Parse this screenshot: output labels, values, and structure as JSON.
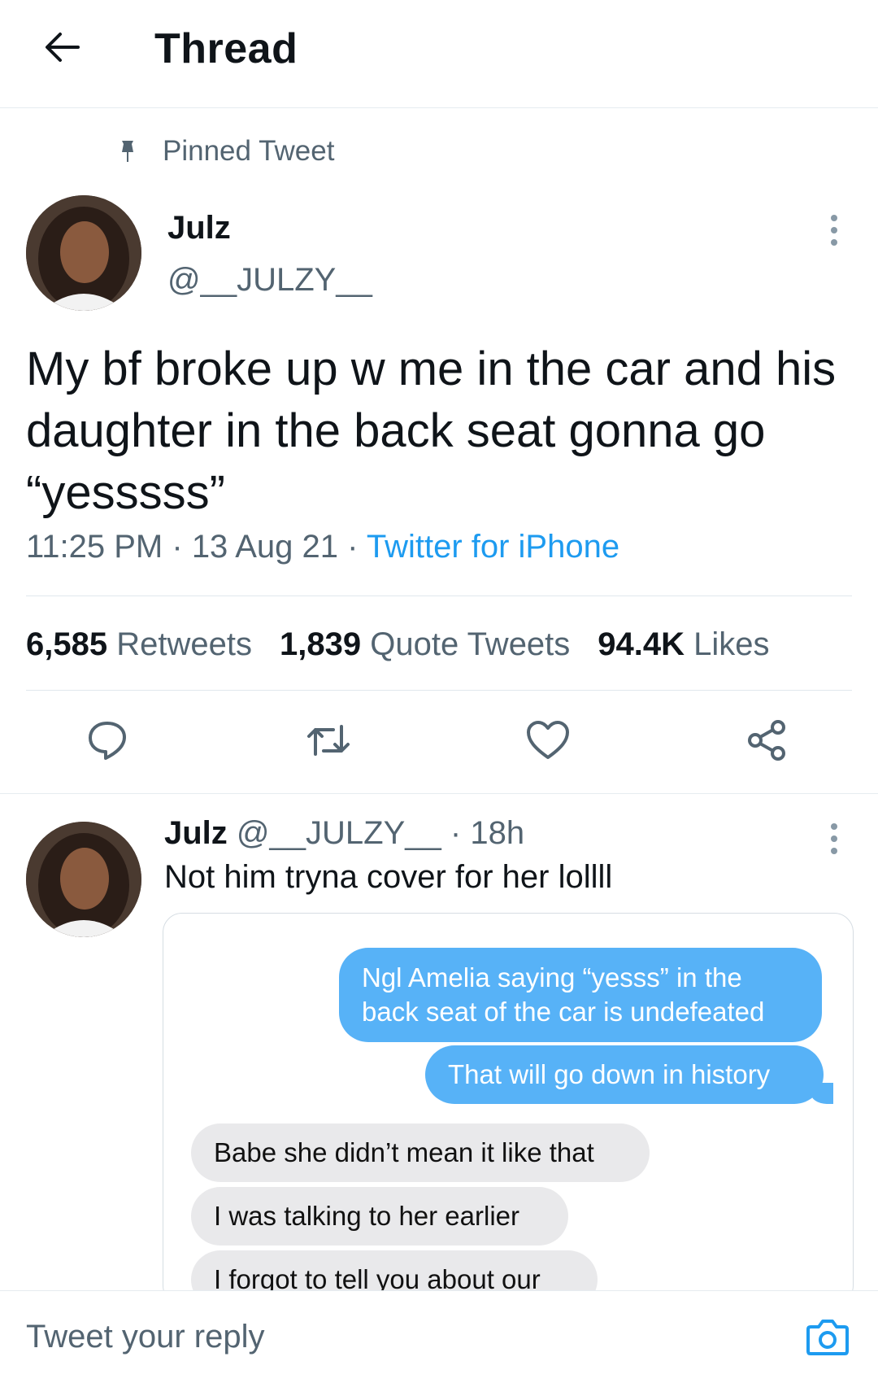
{
  "header": {
    "title": "Thread",
    "back_icon": "arrow-left-icon"
  },
  "pinned": {
    "label": "Pinned Tweet",
    "icon": "pin-icon"
  },
  "tweet": {
    "author_name": "Julz",
    "author_handle": "@__JULZY__",
    "text": "My bf broke up w me in the car and his daughter in the back seat gonna go “yesssss”",
    "time": "11:25 PM",
    "date": "13 Aug 21",
    "source": "Twitter for iPhone",
    "stats": {
      "retweets_count": "6,585",
      "retweets_label": "Retweets",
      "quotes_count": "1,839",
      "quotes_label": "Quote Tweets",
      "likes_count": "94.4K",
      "likes_label": "Likes"
    },
    "actions": [
      "reply-icon",
      "retweet-icon",
      "like-icon",
      "share-icon"
    ]
  },
  "reply": {
    "author_name": "Julz",
    "author_handle": "@__JULZY__",
    "time": "18h",
    "text": "Not him tryna cover for her lollll",
    "media": {
      "messages": [
        {
          "side": "sent",
          "text": "Ngl Amelia saying “yesss” in the back seat of the car is undefeated"
        },
        {
          "side": "sent",
          "text": "That will go down in history"
        },
        {
          "side": "received",
          "text": "Babe she didn’t mean it like that"
        },
        {
          "side": "received",
          "text": "I was talking to her earlier"
        },
        {
          "side": "received",
          "text": "I forgot to tell you about our"
        }
      ]
    }
  },
  "reply_bar": {
    "placeholder": "Tweet your reply",
    "camera_icon": "camera-icon"
  },
  "colors": {
    "accent": "#1d9bf0",
    "muted": "#536471",
    "sent_bubble": "#57b2f7",
    "received_bubble": "#e9e9eb"
  }
}
